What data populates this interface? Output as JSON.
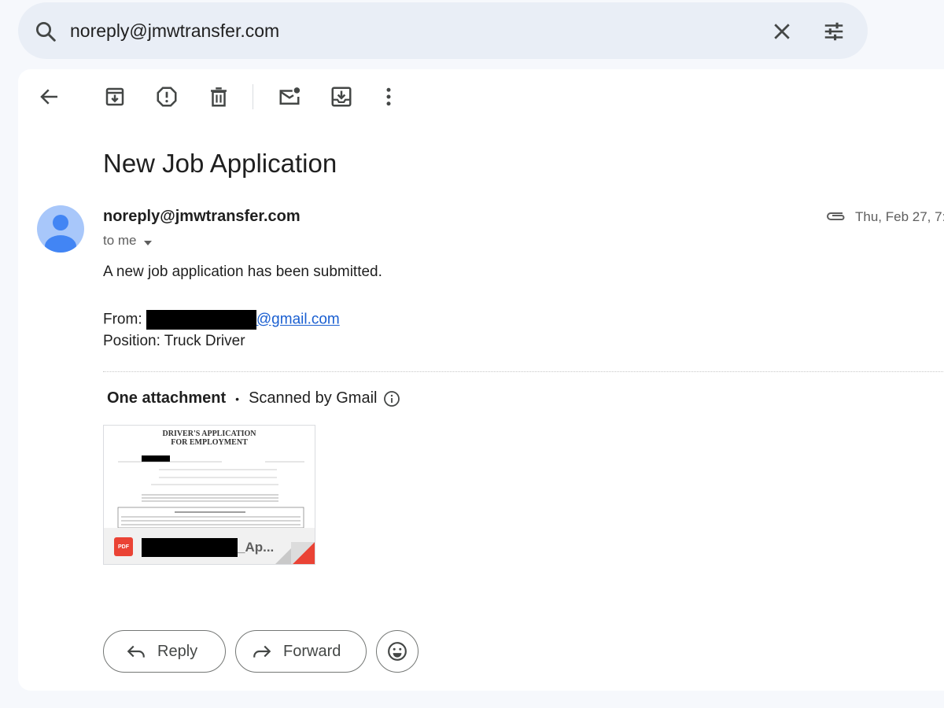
{
  "search": {
    "query": "noreply@jmwtransfer.com"
  },
  "toolbar": {
    "icons": [
      "back-arrow-icon",
      "archive-icon",
      "report-spam-icon",
      "delete-icon",
      "mark-unread-icon",
      "move-to-icon",
      "more-vert-icon"
    ]
  },
  "email": {
    "subject": "New Job Application",
    "sender": "noreply@jmwtransfer.com",
    "recipient_label": "to me",
    "date": "Thu, Feb 27, 7:",
    "body_line1": "A new job application has been submitted.",
    "from_label": "From: ",
    "from_domain": "@gmail.com",
    "position_line": "Position: Truck Driver"
  },
  "attachments": {
    "header": "One attachment",
    "scanned": "Scanned by Gmail",
    "file": {
      "type_badge": "PDF",
      "name_suffix": "_Ap...",
      "preview_title_1": "DRIVER'S APPLICATION",
      "preview_title_2": "FOR EMPLOYMENT"
    }
  },
  "actions": {
    "reply": "Reply",
    "forward": "Forward"
  },
  "colors": {
    "page_bg": "#f6f8fc",
    "search_bg": "#e9eef6",
    "link": "#1a5fd1",
    "avatar": "#4285f4",
    "pdf_red": "#ea4335"
  }
}
